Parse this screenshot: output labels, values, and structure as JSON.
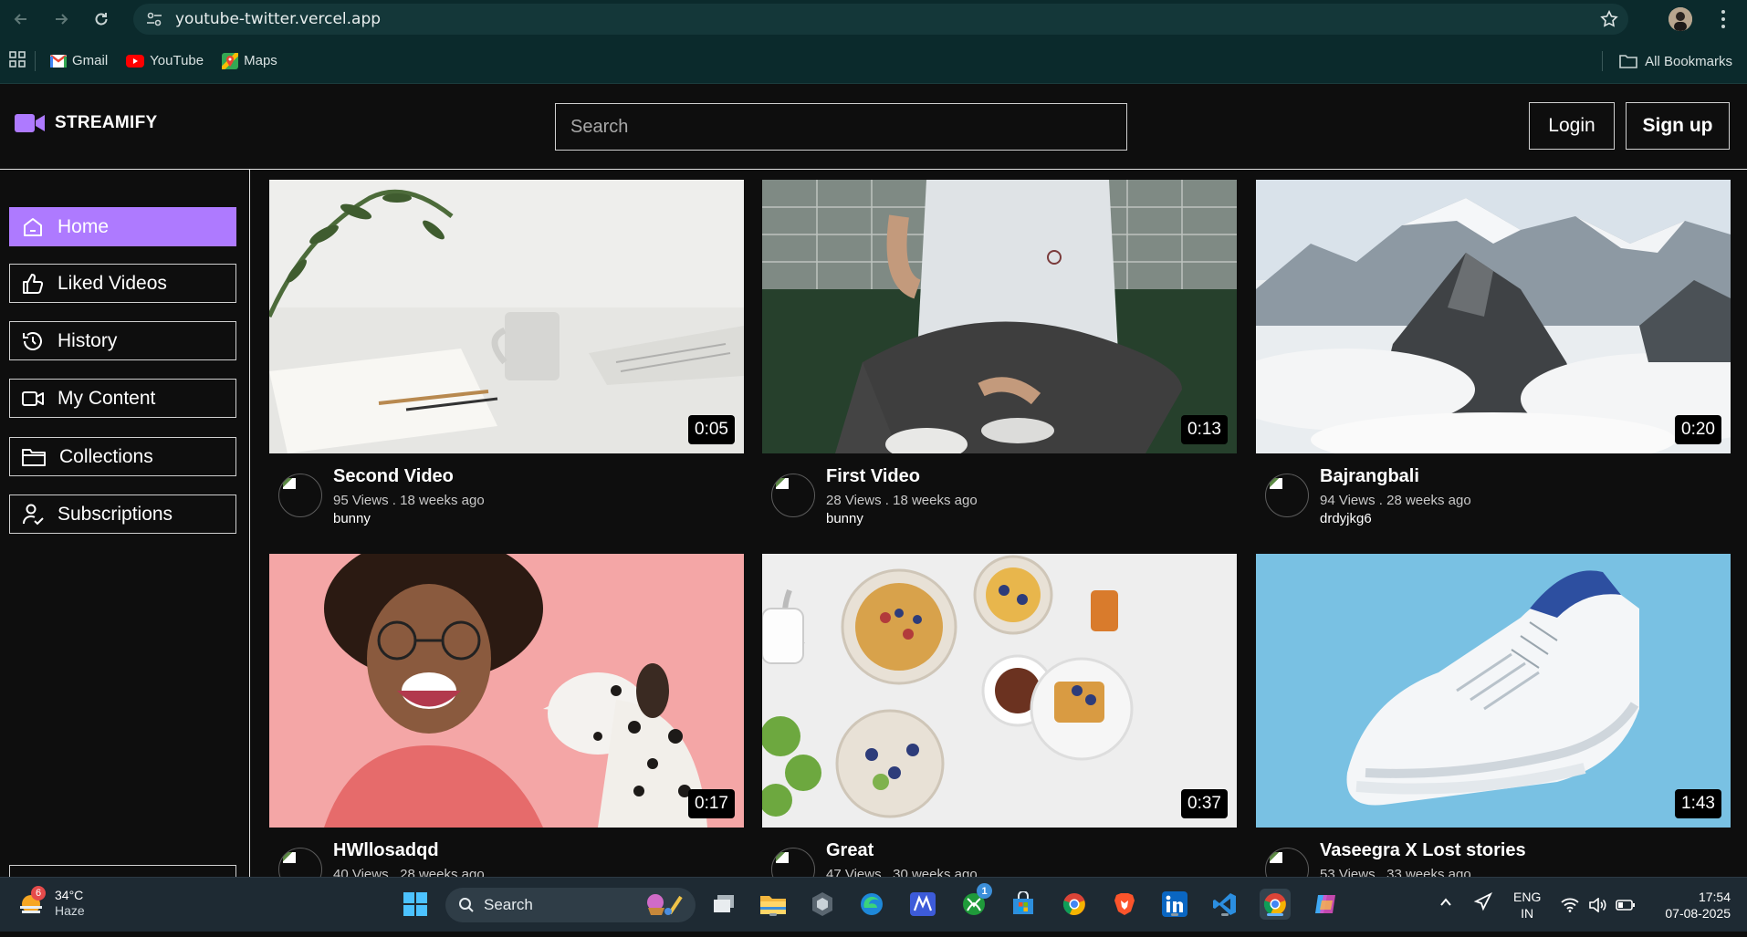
{
  "browser": {
    "url": "youtube-twitter.vercel.app",
    "bookmarks": [
      {
        "label": "Gmail",
        "icon": "gmail-icon"
      },
      {
        "label": "YouTube",
        "icon": "youtube-icon"
      },
      {
        "label": "Maps",
        "icon": "maps-icon"
      }
    ],
    "all_bookmarks": "All Bookmarks"
  },
  "app": {
    "brand": "STREAMIFY",
    "search_placeholder": "Search",
    "login": "Login",
    "signup": "Sign up",
    "accent": "#ae7aff"
  },
  "sidebar": {
    "items": [
      {
        "label": "Home",
        "icon": "home-icon",
        "active": true
      },
      {
        "label": "Liked Videos",
        "icon": "thumbs-up-icon"
      },
      {
        "label": "History",
        "icon": "history-icon"
      },
      {
        "label": "My Content",
        "icon": "video-camera-icon"
      },
      {
        "label": "Collections",
        "icon": "folder-icon"
      },
      {
        "label": "Subscriptions",
        "icon": "user-check-icon"
      }
    ]
  },
  "videos": [
    {
      "title": "Second Video",
      "stats": "95 Views . 18 weeks ago",
      "owner": "bunny",
      "duration": "0:05"
    },
    {
      "title": "First Video",
      "stats": "28 Views . 18 weeks ago",
      "owner": "bunny",
      "duration": "0:13"
    },
    {
      "title": "Bajrangbali",
      "stats": "94 Views . 28 weeks ago",
      "owner": "drdyjkg6",
      "duration": "0:20"
    },
    {
      "title": "HWllosadqd",
      "stats": "40 Views . 28 weeks ago",
      "owner": "",
      "duration": "0:17"
    },
    {
      "title": "Great",
      "stats": "47 Views . 30 weeks ago",
      "owner": "",
      "duration": "0:37"
    },
    {
      "title": "Vaseegra X Lost stories",
      "stats": "53 Views . 33 weeks ago",
      "owner": "",
      "duration": "1:43"
    }
  ],
  "taskbar": {
    "weather_temp": "34°C",
    "weather_cond": "Haze",
    "weather_badge": "6",
    "search_label": "Search",
    "xbox_badge": "1",
    "lang_top": "ENG",
    "lang_bottom": "IN",
    "time": "17:54",
    "date": "07-08-2025"
  }
}
